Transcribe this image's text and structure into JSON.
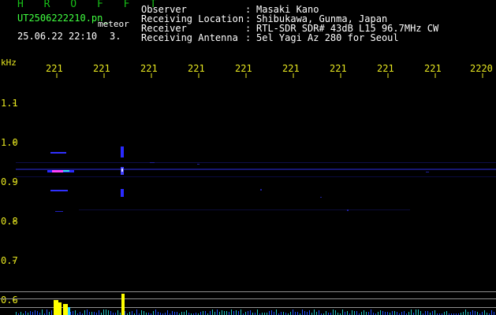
{
  "app": {
    "brand": "H R O F F T",
    "filename": "UT2506222210.pn_",
    "mode": "meteor",
    "datetime": "25.06.22 22:10",
    "index": "3."
  },
  "header": {
    "rows": [
      {
        "label": "Observer",
        "value": "Masaki Kano"
      },
      {
        "label": "Receiving Location",
        "value": "Shibukawa, Gunma, Japan"
      },
      {
        "label": "Receiver",
        "value": "RTL-SDR SDR# 43dB L15 96.7MHz CW"
      },
      {
        "label": "Receiving Antenna",
        "value": "5el Yagi Az 280 for Seoul"
      }
    ],
    "colon": ":"
  },
  "time_axis": {
    "labels": [
      "221",
      "221",
      "221",
      "221",
      "221",
      "221",
      "221",
      "221",
      "221",
      "2220"
    ]
  },
  "freq_axis": {
    "unit": "kHz",
    "labels": [
      "1.1",
      "1.0",
      "0.9",
      "0.8",
      "0.7",
      "0.6"
    ]
  },
  "colors": {
    "axis_text": "#e8e820",
    "brand": "#18c018",
    "signal": "#2a2aff",
    "echo_core": "#ff40ff",
    "trace": "#20c0c0",
    "peak": "#ffff00"
  }
}
